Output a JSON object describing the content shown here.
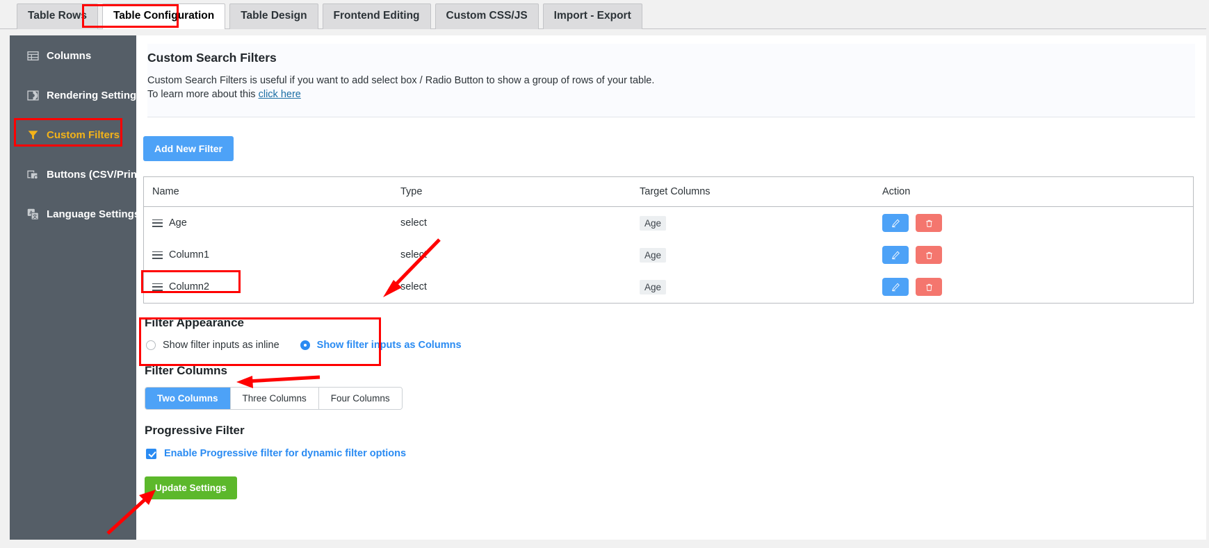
{
  "tabs": [
    {
      "label": "Table Rows",
      "active": false
    },
    {
      "label": "Table Configuration",
      "active": true
    },
    {
      "label": "Table Design",
      "active": false
    },
    {
      "label": "Frontend Editing",
      "active": false
    },
    {
      "label": "Custom CSS/JS",
      "active": false
    },
    {
      "label": "Import - Export",
      "active": false
    }
  ],
  "sidebar": {
    "items": [
      {
        "label": "Columns",
        "icon": "table-grid-icon",
        "active": false
      },
      {
        "label": "Rendering Settings",
        "icon": "rendering-icon",
        "active": false
      },
      {
        "label": "Custom Filters",
        "icon": "funnel-icon",
        "active": true
      },
      {
        "label": "Buttons (CSV/Print)",
        "icon": "copy-buttons-icon",
        "active": false
      },
      {
        "label": "Language Settings",
        "icon": "translate-icon",
        "active": false
      }
    ]
  },
  "info": {
    "title": "Custom Search Filters",
    "line1": "Custom Search Filters is useful if you want to add select box / Radio Button to show a group of rows of your table.",
    "line2_prefix": "To learn more about this ",
    "link": "click here"
  },
  "add_filter_label": "Add New Filter",
  "table": {
    "headers": [
      "Name",
      "Type",
      "Target Columns",
      "Action"
    ],
    "rows": [
      {
        "name": "Age",
        "type": "select",
        "target": "Age",
        "edit": "edit-icon",
        "delete": "trash-icon"
      },
      {
        "name": "Column1",
        "type": "select",
        "target": "Age",
        "edit": "edit-icon",
        "delete": "trash-icon"
      },
      {
        "name": "Column2",
        "type": "select",
        "target": "Age",
        "edit": "edit-icon",
        "delete": "trash-icon"
      }
    ]
  },
  "filter_appearance": {
    "title": "Filter Appearance",
    "options": [
      {
        "label": "Show filter inputs as inline",
        "selected": false
      },
      {
        "label": "Show filter inputs as Columns",
        "selected": true
      }
    ]
  },
  "filter_columns": {
    "title": "Filter Columns",
    "options": [
      {
        "label": "Two Columns",
        "active": true
      },
      {
        "label": "Three Columns",
        "active": false
      },
      {
        "label": "Four Columns",
        "active": false
      }
    ]
  },
  "progressive_filter": {
    "title": "Progressive Filter",
    "checkbox_label": "Enable Progressive filter for dynamic filter options",
    "checked": true
  },
  "update_label": "Update Settings",
  "colors": {
    "accent_blue": "#4da2f7",
    "radio_blue": "#2a8bf2",
    "danger_red": "#f4766e",
    "success_green": "#5cb82b",
    "sidebar_bg": "#555e67",
    "sidebar_active": "#f3b319",
    "annotation_red": "#ff0000"
  }
}
